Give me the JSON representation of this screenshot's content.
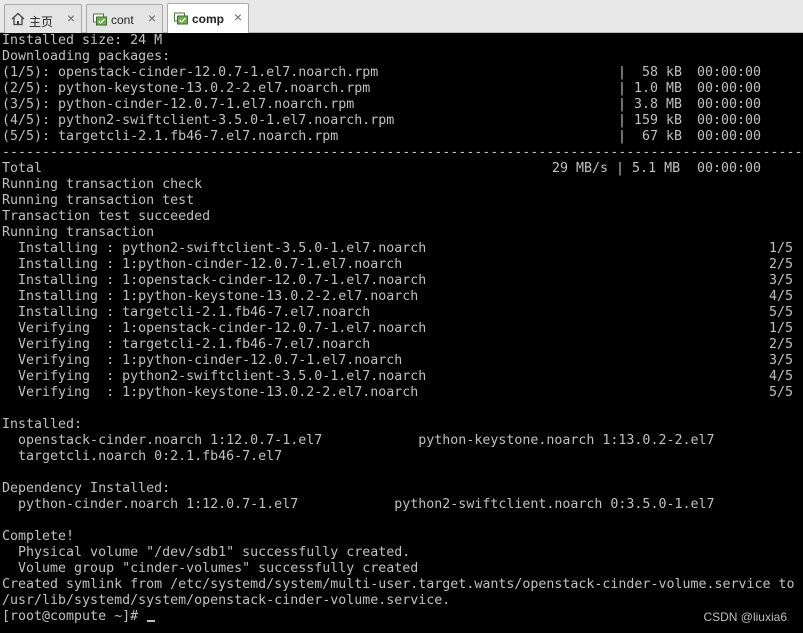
{
  "tabs": [
    {
      "label": "主页",
      "icon": "home-icon"
    },
    {
      "label": "cont",
      "icon": "vm-icon"
    },
    {
      "label": "comp",
      "icon": "vm-icon",
      "active": true
    }
  ],
  "terminal": {
    "lines": [
      "Installed size: 24 M",
      "Downloading packages:",
      "(1/5): openstack-cinder-12.0.7-1.el7.noarch.rpm",
      "(2/5): python-keystone-13.0.2-2.el7.noarch.rpm",
      "(3/5): python-cinder-12.0.7-1.el7.noarch.rpm",
      "(4/5): python2-swiftclient-3.5.0-1.el7.noarch.rpm",
      "(5/5): targetcli-2.1.fb46-7.el7.noarch.rpm",
      "------------------------------------------------------------------------------------------------------------------------------------------",
      "Total",
      "Running transaction check",
      "Running transaction test",
      "Transaction test succeeded",
      "Running transaction",
      "  Installing : python2-swiftclient-3.5.0-1.el7.noarch",
      "  Installing : 1:python-cinder-12.0.7-1.el7.noarch",
      "  Installing : 1:openstack-cinder-12.0.7-1.el7.noarch",
      "  Installing : 1:python-keystone-13.0.2-2.el7.noarch",
      "  Installing : targetcli-2.1.fb46-7.el7.noarch",
      "  Verifying  : 1:openstack-cinder-12.0.7-1.el7.noarch",
      "  Verifying  : targetcli-2.1.fb46-7.el7.noarch",
      "  Verifying  : 1:python-cinder-12.0.7-1.el7.noarch",
      "  Verifying  : python2-swiftclient-3.5.0-1.el7.noarch",
      "  Verifying  : 1:python-keystone-13.0.2-2.el7.noarch",
      "",
      "Installed:",
      "  openstack-cinder.noarch 1:12.0.7-1.el7            python-keystone.noarch 1:13.0.2-2.el7",
      "  targetcli.noarch 0:2.1.fb46-7.el7",
      "",
      "Dependency Installed:",
      "  python-cinder.noarch 1:12.0.7-1.el7            python2-swiftclient.noarch 0:3.5.0-1.el7",
      "",
      "Complete!",
      "  Physical volume \"/dev/sdb1\" successfully created.",
      "  Volume group \"cinder-volumes\" successfully created",
      "Created symlink from /etc/systemd/system/multi-user.target.wants/openstack-cinder-volume.service to",
      "/usr/lib/systemd/system/openstack-cinder-volume.service.",
      "[root@compute ~]# "
    ],
    "download_stats": [
      {
        "size": "|  58 kB",
        "time": "00:00:00"
      },
      {
        "size": "| 1.0 MB",
        "time": "00:00:00"
      },
      {
        "size": "| 3.8 MB",
        "time": "00:00:00"
      },
      {
        "size": "| 159 kB",
        "time": "00:00:00"
      },
      {
        "size": "|  67 kB",
        "time": "00:00:00"
      }
    ],
    "total_stats": {
      "speed": "29 MB/s | 5.1 MB",
      "time": "00:00:00"
    },
    "progress": [
      "1/5",
      "2/5",
      "3/5",
      "4/5",
      "5/5",
      "1/5",
      "2/5",
      "3/5",
      "4/5",
      "5/5"
    ]
  },
  "watermark": "CSDN @liuxia6"
}
